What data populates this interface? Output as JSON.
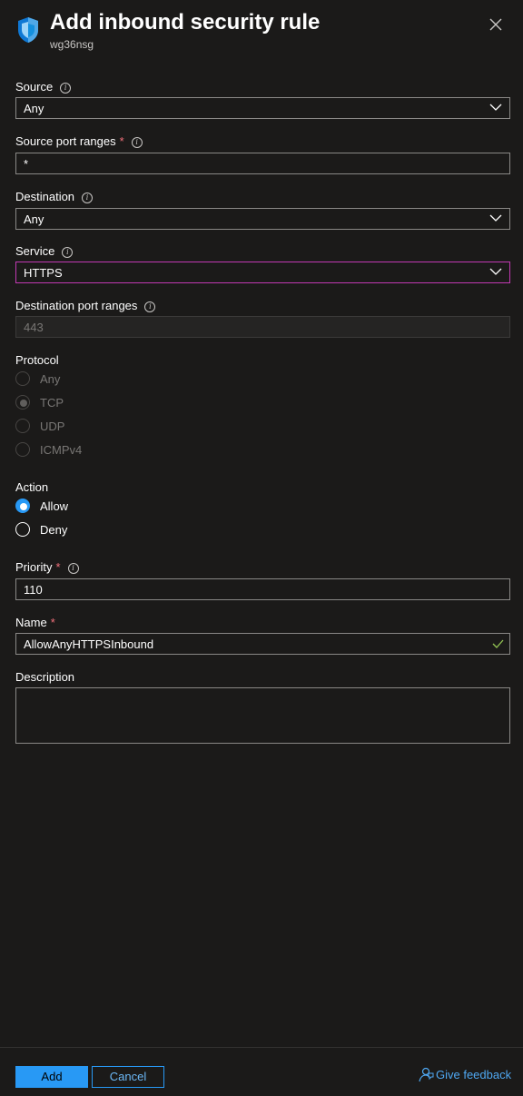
{
  "header": {
    "title": "Add inbound security rule",
    "subtitle": "wg36nsg",
    "icon": "shield-icon",
    "close_icon": "close-icon"
  },
  "source": {
    "label": "Source",
    "value": "Any"
  },
  "source_port": {
    "label": "Source port ranges",
    "required": "*",
    "value": "*"
  },
  "destination": {
    "label": "Destination",
    "value": "Any"
  },
  "service": {
    "label": "Service",
    "value": "HTTPS"
  },
  "destination_port": {
    "label": "Destination port ranges",
    "value": "443"
  },
  "protocol": {
    "label": "Protocol",
    "options": [
      "Any",
      "TCP",
      "UDP",
      "ICMPv4"
    ],
    "selected": "TCP"
  },
  "action": {
    "label": "Action",
    "options": [
      "Allow",
      "Deny"
    ],
    "selected": "Allow"
  },
  "priority": {
    "label": "Priority",
    "required": "*",
    "value": "110"
  },
  "name": {
    "label": "Name",
    "required": "*",
    "value": "AllowAnyHTTPSInbound"
  },
  "description": {
    "label": "Description",
    "value": ""
  },
  "footer": {
    "add_label": "Add",
    "cancel_label": "Cancel",
    "feedback_label": "Give feedback"
  },
  "colors": {
    "background": "#1b1a19",
    "accent": "#2899f5",
    "focus_border": "#c239b3",
    "required": "#f1707b",
    "valid_check": "#92c353"
  }
}
